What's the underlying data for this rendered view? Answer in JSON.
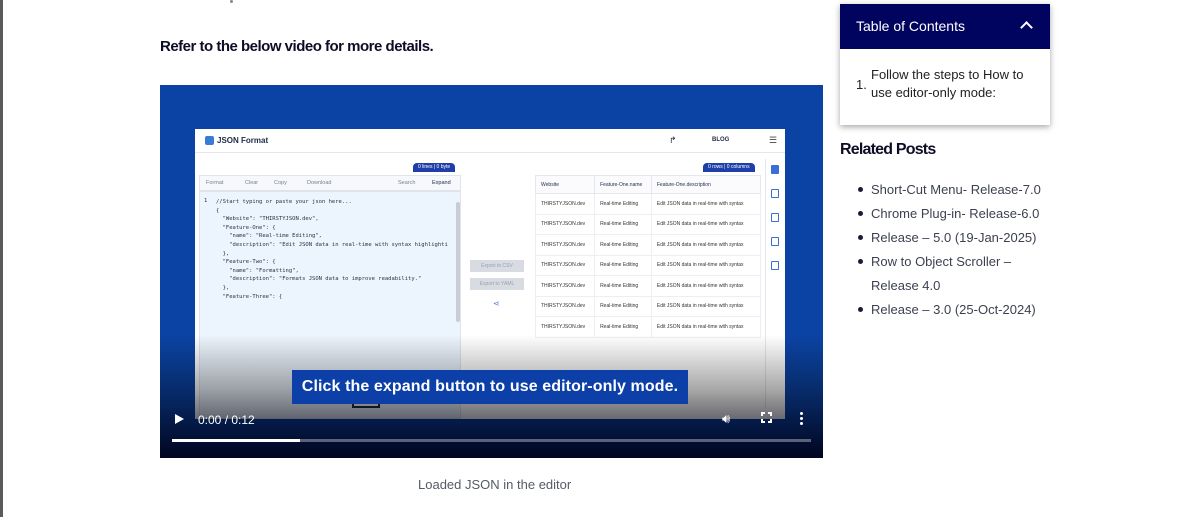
{
  "article": {
    "intro": "Refer to the below video for more details.",
    "video_caption": "Loaded JSON in the editor"
  },
  "video": {
    "overlay_caption": "Click the expand button to use editor-only mode.",
    "time": "0:00 / 0:12",
    "progress": 0.2,
    "app": {
      "logo": "JSON Format",
      "blog": "BLOG",
      "badge_left": "0 lines | 0 byte",
      "badge_right": "0 rows | 0 columns",
      "toolbar": [
        "Format",
        "Clear",
        "Copy",
        "Download",
        "Search",
        "Expand"
      ],
      "line_number": "1",
      "code": "//Start typing or paste your json here...\n{\n  \"Website\": \"THIRSTYJSON.dev\",\n  \"Feature-One\": {\n    \"name\": \"Real-time Editing\",\n    \"description\": \"Edit JSON data in real-time with syntax highlighti\n  },\n  \"Feature-Two\": {\n    \"name\": \"Formatting\",\n    \"description\": \"Formats JSON data to improve readability.\"\n  },\n  \"Feature-Three\": {",
      "export_csv": "Export to CSV",
      "export_yaml": "Export to YAML",
      "table_headers": [
        "Website",
        "Feature-One.name",
        "Feature-One.description"
      ],
      "table_rows": [
        [
          "THIRSTYJSON.dev",
          "Real-time Editing",
          "Edit JSON data in real-time with syntax"
        ],
        [
          "THIRSTYJSON.dev",
          "Real-time Editing",
          "Edit JSON data in real-time with syntax"
        ],
        [
          "THIRSTYJSON.dev",
          "Real-time Editing",
          "Edit JSON data in real-time with syntax"
        ],
        [
          "THIRSTYJSON.dev",
          "Real-time Editing",
          "Edit JSON data in real-time with syntax"
        ],
        [
          "THIRSTYJSON.dev",
          "Real-time Editing",
          "Edit JSON data in real-time with syntax"
        ],
        [
          "THIRSTYJSON.dev",
          "Real-time Editing",
          "Edit JSON data in real-time with syntax"
        ],
        [
          "THIRSTYJSON.dev",
          "Real-time Editing",
          "Edit JSON data in real-time with syntax"
        ]
      ]
    }
  },
  "toc": {
    "title": "Table of Contents",
    "items": [
      {
        "num": "1.",
        "text": "Follow the steps to How to use editor-only mode:"
      }
    ]
  },
  "related": {
    "title": "Related Posts",
    "items": [
      "Short-Cut Menu- Release-7.0",
      "Chrome Plug-in- Release-6.0",
      "Release – 5.0 (19-Jan-2025)",
      "Row to Object Scroller – Release 4.0",
      "Release – 3.0 (25-Oct-2024)"
    ]
  },
  "colors": {
    "toc_header": "#01045e",
    "video_bg": "#0b43a4",
    "caption_bg": "#0c3fa8"
  }
}
